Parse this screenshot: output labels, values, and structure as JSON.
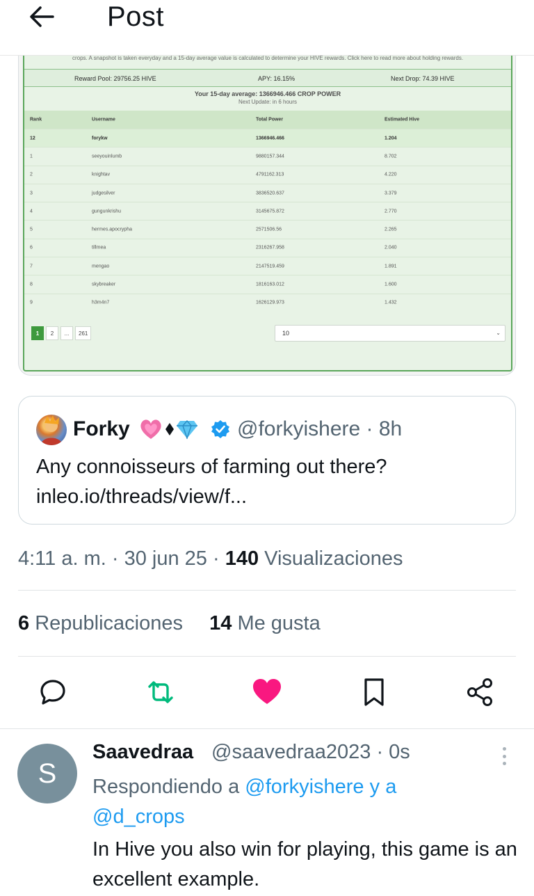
{
  "header": {
    "title": "Post"
  },
  "media": {
    "note": "crops. A snapshot is taken everyday and a 15-day average value is calculated to determine your HIVE rewards. Click here to read more about holding rewards.",
    "stats": {
      "reward_pool": "Reward Pool: 29756.25 HIVE",
      "apy": "APY: 16.15%",
      "next_drop": "Next Drop: 74.39 HIVE"
    },
    "average": {
      "title": "Your 15-day average: 1366946.466 CROP POWER",
      "subtitle": "Next Update: in 6 hours"
    },
    "columns": [
      "Rank",
      "Username",
      "Total Power",
      "Estimated Hive"
    ],
    "rows": [
      {
        "rank": "12",
        "username": "forykw",
        "power": "1366946.466",
        "hive": "1.204"
      },
      {
        "rank": "1",
        "username": "seeyouinlumb",
        "power": "9880157.344",
        "hive": "8.702"
      },
      {
        "rank": "2",
        "username": "knightav",
        "power": "4791162.313",
        "hive": "4.220"
      },
      {
        "rank": "3",
        "username": "judgesilver",
        "power": "3836520.637",
        "hive": "3.379"
      },
      {
        "rank": "4",
        "username": "gungunkrishu",
        "power": "3145675.872",
        "hive": "2.770"
      },
      {
        "rank": "5",
        "username": "hermes.apocrypha",
        "power": "2571506.56",
        "hive": "2.265"
      },
      {
        "rank": "6",
        "username": "tillmea",
        "power": "2316267.958",
        "hive": "2.040"
      },
      {
        "rank": "7",
        "username": "mengao",
        "power": "2147519.459",
        "hive": "1.891"
      },
      {
        "rank": "8",
        "username": "skybreaker",
        "power": "1816163.012",
        "hive": "1.600"
      },
      {
        "rank": "9",
        "username": "h3m4n7",
        "power": "1626129.973",
        "hive": "1.432"
      }
    ],
    "pager": [
      "1",
      "2",
      "...",
      "261"
    ],
    "page_size": "10"
  },
  "quote": {
    "name": "Forky",
    "handle": "@forkyishere · 8h",
    "text_line1": "Any connoisseurs of farming out there?",
    "text_line2": "inleo.io/threads/view/f..."
  },
  "meta": {
    "time": "4:11 a. m. · 30 jun 25 · ",
    "views_count": "140",
    "views_label": " Visualizaciones"
  },
  "counts": {
    "reposts_count": "6",
    "reposts_label": " Republicaciones",
    "likes_count": "14",
    "likes_label": " Me gusta"
  },
  "reply": {
    "avatar_letter": "S",
    "name": "Saavedraa",
    "handle": "@saavedraa2023 · 0s",
    "replying_prefix": "Respondiendo a ",
    "replying_user1": "@forkyishere",
    "replying_mid": " y a ",
    "replying_user2": "@d_crops",
    "text": "In Hive you also win for playing, this game is an excellent example."
  },
  "colors": {
    "accent": "#1d9bf0",
    "repost": "#00ba7c",
    "like": "#f91880",
    "verified": "#1d9bf0"
  },
  "icons": [
    "arrow-left-icon",
    "reply-icon",
    "repost-icon",
    "heart-icon",
    "bookmark-icon",
    "share-icon",
    "verified-icon",
    "more-vertical-icon"
  ]
}
